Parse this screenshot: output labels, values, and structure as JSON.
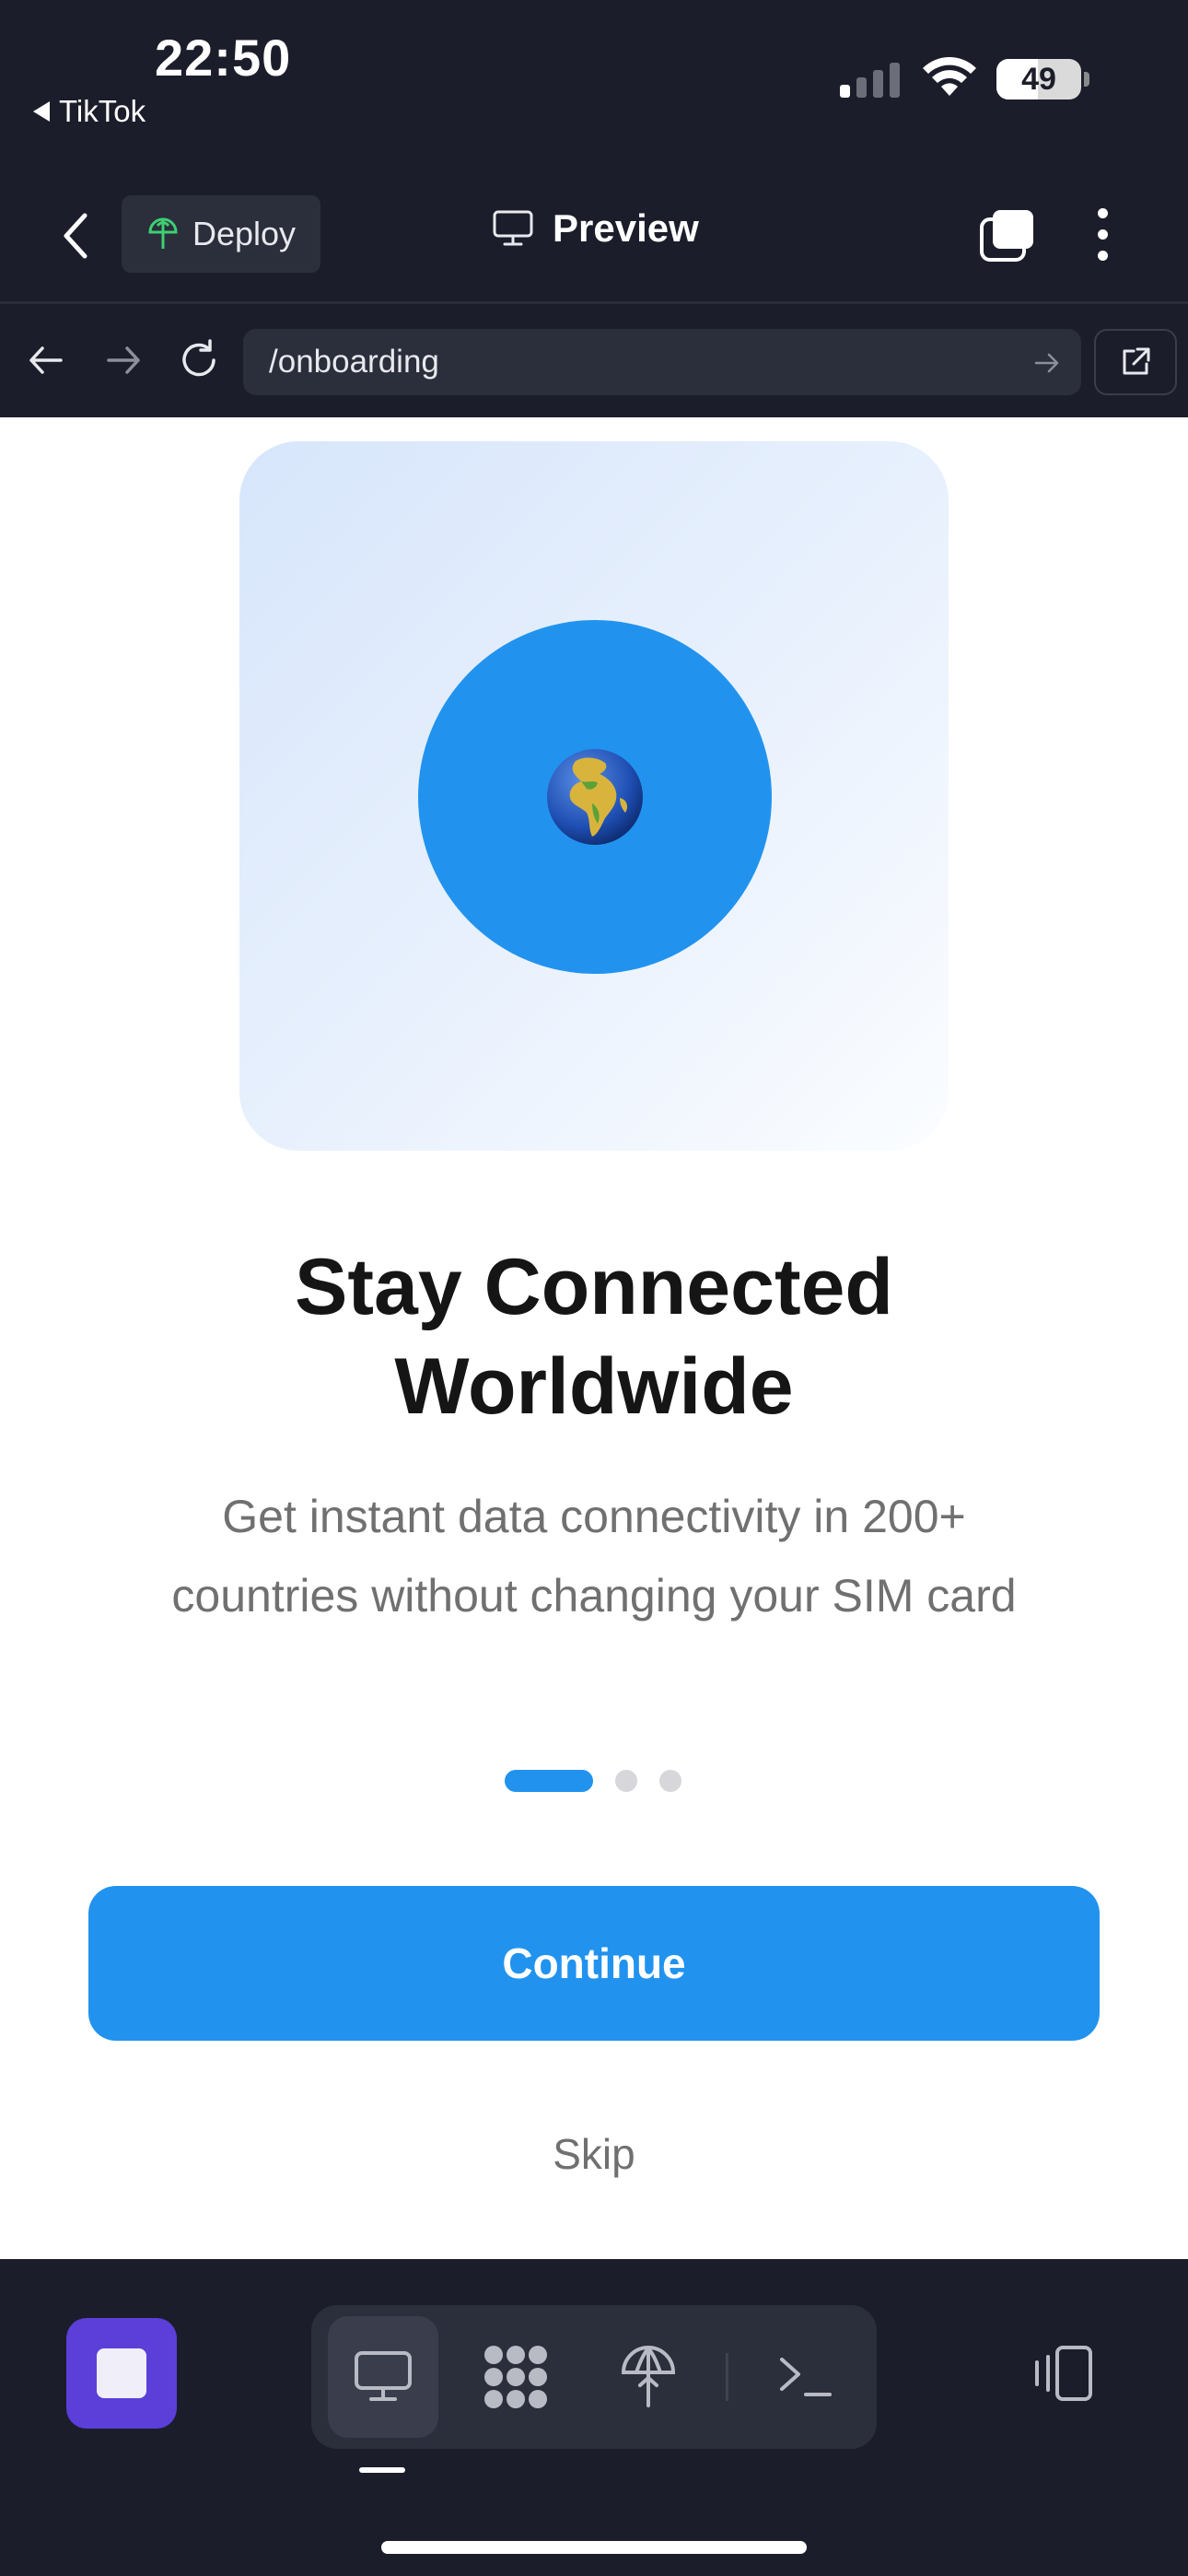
{
  "status_bar": {
    "time": "22:50",
    "back_app": "TikTok",
    "battery": "49"
  },
  "header": {
    "deploy_label": "Deploy",
    "preview_label": "Preview"
  },
  "url_bar": {
    "url": "/onboarding"
  },
  "onboarding": {
    "hero_icon": "globe-emoji",
    "title_line1": "Stay Connected",
    "title_line2": "Worldwide",
    "subtitle_line1": "Get instant data connectivity in 200+",
    "subtitle_line2": "countries without changing your SIM card",
    "pagination": {
      "total": 3,
      "current": 1
    },
    "continue_label": "Continue",
    "skip_label": "Skip"
  },
  "toolbar": {
    "items": [
      "desktop-icon",
      "grid-icon",
      "deploy-icon",
      "terminal-icon"
    ],
    "active": "desktop-icon"
  },
  "colors": {
    "accent": "#2193ef",
    "dark_bg": "#1b1d2a",
    "stop_button": "#5b3fd8"
  }
}
